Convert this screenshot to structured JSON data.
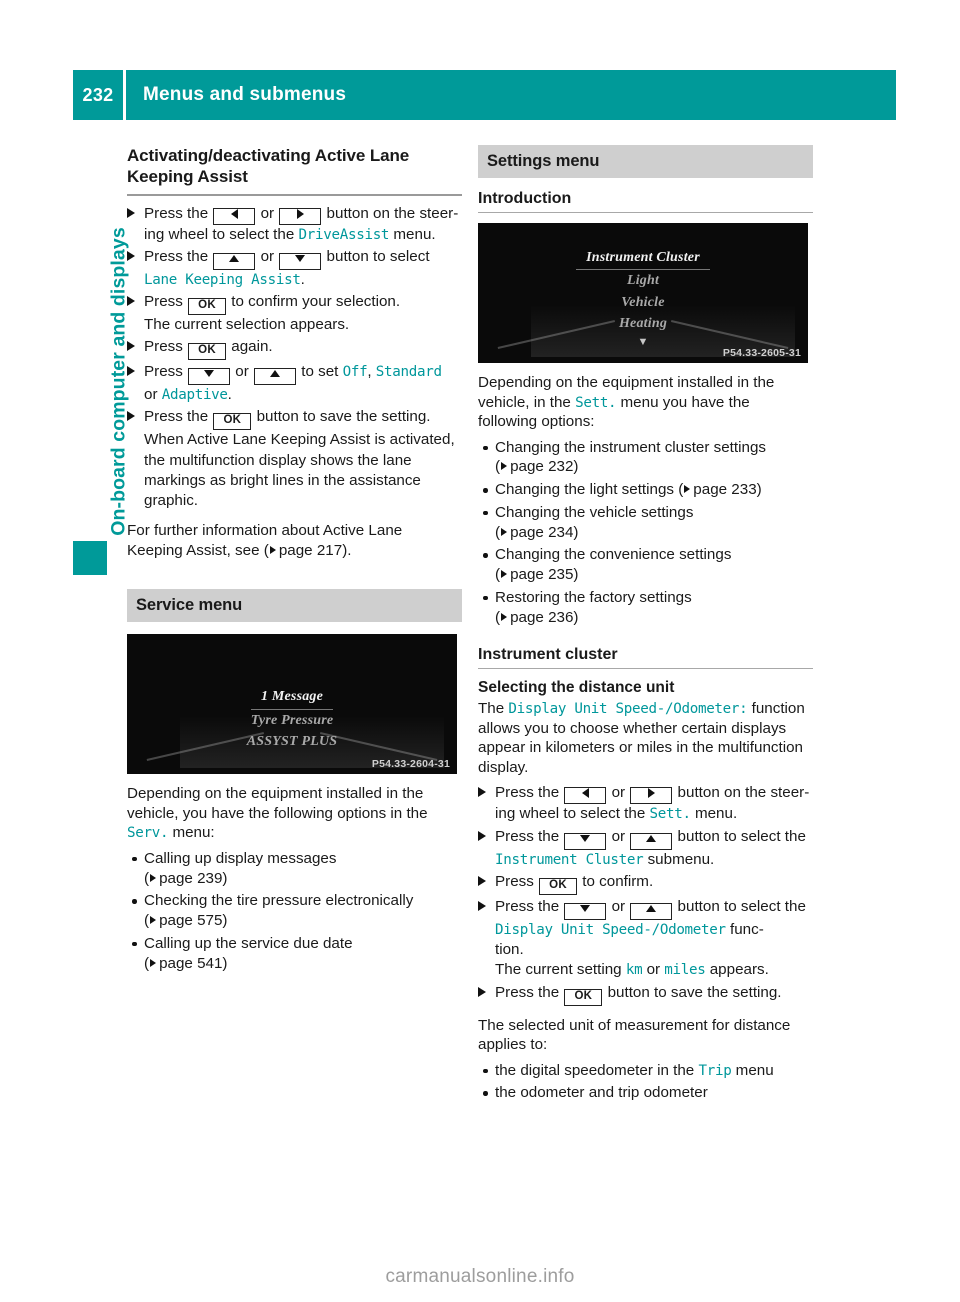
{
  "header": {
    "page_number": "232",
    "title": "Menus and submenus"
  },
  "side_tab": {
    "label": "On-board computer and displays"
  },
  "colors": {
    "accent_teal": "#009a99",
    "display_text_teal": "#00979b",
    "band_grey": "#cfcfcf"
  },
  "left_column": {
    "heading": "Activating/deactivating Active Lane Keeping Assist",
    "steps": [
      {
        "parts": [
          {
            "t": "text",
            "v": "Press the "
          },
          {
            "t": "key",
            "v": "left-arrow"
          },
          {
            "t": "text",
            "v": " or "
          },
          {
            "t": "key",
            "v": "right-arrow"
          },
          {
            "t": "text",
            "v": " button on the steer-"
          }
        ],
        "cont": [
          {
            "t": "text",
            "v": "ing wheel to select the "
          },
          {
            "t": "disp",
            "v": "DriveAssist"
          },
          {
            "t": "text",
            "v": " menu."
          }
        ]
      },
      {
        "parts": [
          {
            "t": "text",
            "v": "Press the "
          },
          {
            "t": "key",
            "v": "up-arrow"
          },
          {
            "t": "text",
            "v": " or "
          },
          {
            "t": "key",
            "v": "down-arrow"
          },
          {
            "t": "text",
            "v": " button to select"
          }
        ],
        "cont": [
          {
            "t": "disp",
            "v": "Lane Keeping Assist"
          },
          {
            "t": "text",
            "v": "."
          }
        ]
      },
      {
        "parts": [
          {
            "t": "text",
            "v": "Press "
          },
          {
            "t": "key",
            "v": "OK"
          },
          {
            "t": "text",
            "v": " to confirm your selection."
          }
        ],
        "cont": [
          {
            "t": "text",
            "v": "The current selection appears."
          }
        ]
      },
      {
        "parts": [
          {
            "t": "text",
            "v": "Press "
          },
          {
            "t": "key",
            "v": "OK"
          },
          {
            "t": "text",
            "v": " again."
          }
        ],
        "cont": []
      },
      {
        "parts": [
          {
            "t": "text",
            "v": "Press "
          },
          {
            "t": "key",
            "v": "down-arrow"
          },
          {
            "t": "text",
            "v": " or "
          },
          {
            "t": "key",
            "v": "up-arrow"
          },
          {
            "t": "text",
            "v": " to set "
          },
          {
            "t": "disp",
            "v": "Off"
          },
          {
            "t": "text",
            "v": ", "
          },
          {
            "t": "disp",
            "v": "Standard"
          }
        ],
        "cont": [
          {
            "t": "text",
            "v": "or "
          },
          {
            "t": "disp",
            "v": "Adaptive"
          },
          {
            "t": "text",
            "v": "."
          }
        ]
      },
      {
        "parts": [
          {
            "t": "text",
            "v": "Press the "
          },
          {
            "t": "key",
            "v": "OK"
          },
          {
            "t": "text",
            "v": " button to save the setting."
          }
        ],
        "cont": [
          {
            "t": "text",
            "v": "When Active Lane Keeping Assist is activated, the multifunction display shows the lane markings as bright lines in the assistance graphic."
          }
        ]
      }
    ],
    "closing_paragraph": {
      "before": "For further information about Active Lane Keeping Assist, see (",
      "page_ref": "page 217",
      "after": ")."
    },
    "service_section": {
      "band_title": "Service menu",
      "figure": {
        "lines": [
          "1 Message",
          "Tyre Pressure",
          "ASSYST PLUS"
        ],
        "code": "P54.33-2604-31"
      },
      "intro": {
        "before": "Depending on the equipment installed in the vehicle, you have the following options in the ",
        "menu": "Serv.",
        "after": " menu:"
      },
      "options": [
        {
          "label": "Calling up display messages",
          "page_ref": "page 239"
        },
        {
          "label": "Checking the tire pressure electronically",
          "page_ref": "page 575"
        },
        {
          "label": "Calling up the service due date",
          "page_ref": "page 541"
        }
      ]
    }
  },
  "right_column": {
    "band_title": "Settings menu",
    "intro_heading": "Introduction",
    "figure": {
      "lines": [
        "Instrument Cluster",
        "Light",
        "Vehicle",
        "Heating"
      ],
      "caret": "▼",
      "code": "P54.33-2605-31"
    },
    "intro": {
      "before": "Depending on the equipment installed in the vehicle, in the ",
      "menu": "Sett.",
      "after": " menu you have the following options:"
    },
    "options": [
      {
        "label": "Changing the instrument cluster settings",
        "page_ref": "page 232",
        "inline": false
      },
      {
        "label": "Changing the light settings",
        "page_ref": "page 233",
        "inline": true
      },
      {
        "label": "Changing the vehicle settings",
        "page_ref": "page 234",
        "inline": false
      },
      {
        "label": "Changing the convenience settings",
        "page_ref": "page 235",
        "inline": false
      },
      {
        "label": "Restoring the factory settings",
        "page_ref": "page 236",
        "inline": false
      }
    ],
    "instrument_cluster": {
      "heading": "Instrument cluster",
      "sub_heading": "Selecting the distance unit",
      "description": {
        "before": "The ",
        "function": "Display Unit Speed-/Odometer:",
        "after": " function allows you to choose whether certain displays appear in kilometers or miles in the multifunction display."
      },
      "steps": [
        {
          "parts": [
            {
              "t": "text",
              "v": "Press the "
            },
            {
              "t": "key",
              "v": "left-arrow"
            },
            {
              "t": "text",
              "v": " or "
            },
            {
              "t": "key",
              "v": "right-arrow"
            },
            {
              "t": "text",
              "v": " button on the steer-"
            }
          ],
          "cont": [
            {
              "t": "text",
              "v": "ing wheel to select the "
            },
            {
              "t": "disp",
              "v": "Sett."
            },
            {
              "t": "text",
              "v": " menu."
            }
          ]
        },
        {
          "parts": [
            {
              "t": "text",
              "v": "Press the "
            },
            {
              "t": "key",
              "v": "down-arrow"
            },
            {
              "t": "text",
              "v": " or "
            },
            {
              "t": "key",
              "v": "up-arrow"
            },
            {
              "t": "text",
              "v": " button to select the"
            }
          ],
          "cont": [
            {
              "t": "disp",
              "v": "Instrument Cluster"
            },
            {
              "t": "text",
              "v": " submenu."
            }
          ]
        },
        {
          "parts": [
            {
              "t": "text",
              "v": "Press "
            },
            {
              "t": "key",
              "v": "OK"
            },
            {
              "t": "text",
              "v": " to confirm."
            }
          ],
          "cont": []
        },
        {
          "parts": [
            {
              "t": "text",
              "v": "Press the "
            },
            {
              "t": "key",
              "v": "down-arrow"
            },
            {
              "t": "text",
              "v": " or "
            },
            {
              "t": "key",
              "v": "up-arrow"
            },
            {
              "t": "text",
              "v": " button to select the"
            }
          ],
          "cont": [
            {
              "t": "disp",
              "v": "Display Unit Speed-/Odometer"
            },
            {
              "t": "text",
              "v": " func-"
            },
            {
              "t": "br"
            },
            {
              "t": "text",
              "v": "tion."
            },
            {
              "t": "br"
            },
            {
              "t": "text",
              "v": "The current setting "
            },
            {
              "t": "disp",
              "v": "km"
            },
            {
              "t": "text",
              "v": " or "
            },
            {
              "t": "disp",
              "v": "miles"
            },
            {
              "t": "text",
              "v": " appears."
            }
          ]
        },
        {
          "parts": [
            {
              "t": "text",
              "v": "Press the "
            },
            {
              "t": "key",
              "v": "OK"
            },
            {
              "t": "text",
              "v": " button to save the setting."
            }
          ],
          "cont": []
        }
      ],
      "applies_paragraph": "The selected unit of measurement for distance applies to:",
      "applies_items": [
        {
          "before": "the digital speedometer in the ",
          "menu": "Trip",
          "after": " menu"
        },
        {
          "before": "the odometer and trip odometer",
          "menu": "",
          "after": ""
        }
      ]
    }
  },
  "footer": {
    "watermark": "carmanualsonline.info"
  }
}
